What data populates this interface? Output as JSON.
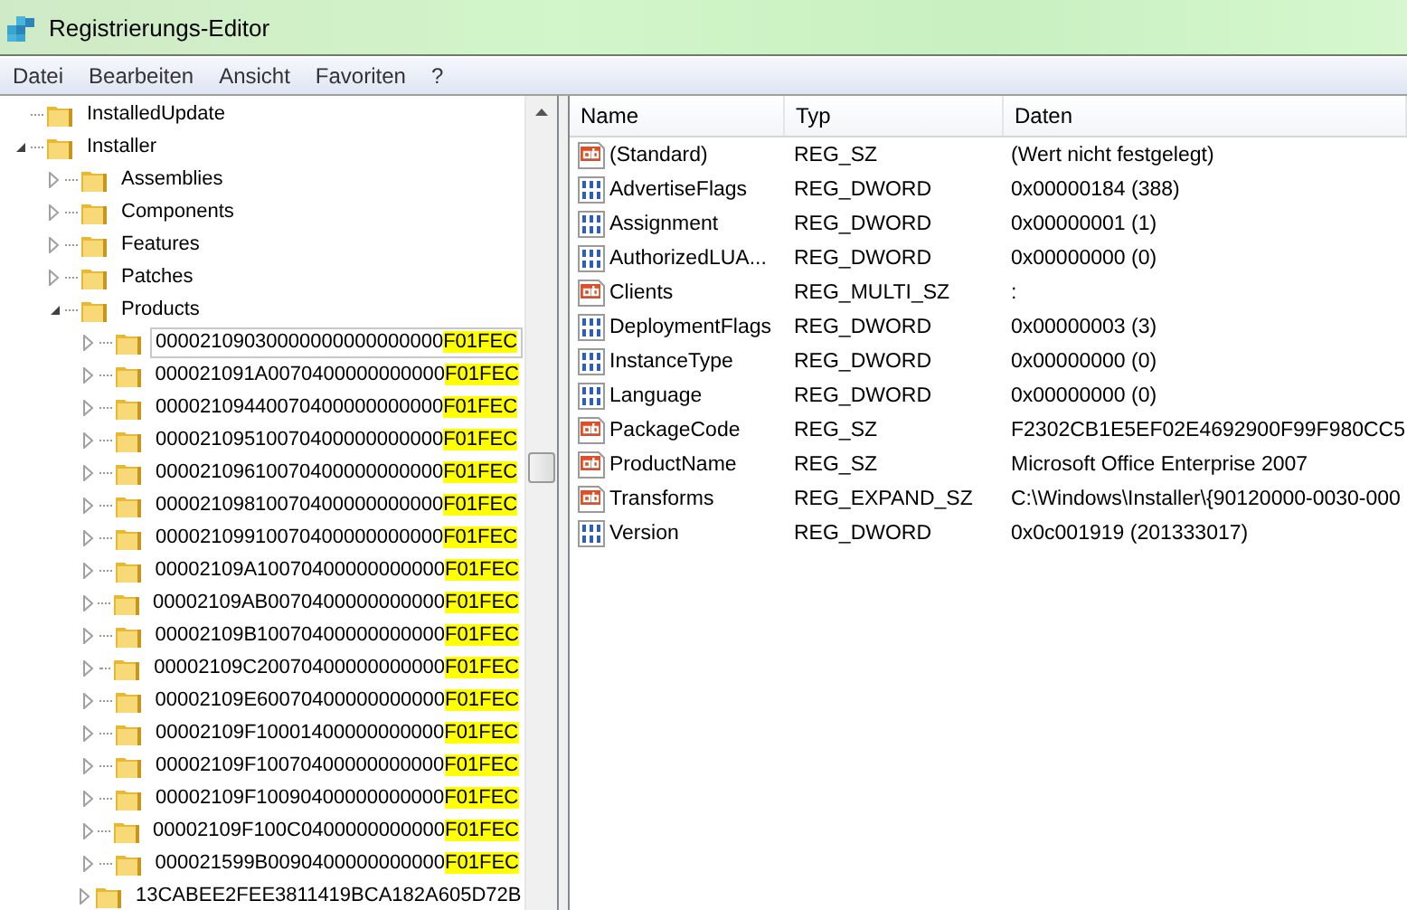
{
  "window": {
    "title": "Registrierungs-Editor"
  },
  "menu": [
    "Datei",
    "Bearbeiten",
    "Ansicht",
    "Favoriten",
    "?"
  ],
  "tree": [
    {
      "label": "InstalledUpdate"
    },
    {
      "label": "Installer",
      "expanded": true,
      "children": [
        {
          "label": "Assemblies",
          "expanded": false
        },
        {
          "label": "Components",
          "expanded": false
        },
        {
          "label": "Features",
          "expanded": false
        },
        {
          "label": "Patches",
          "expanded": false
        },
        {
          "label": "Products",
          "expanded": true,
          "children": [
            {
              "label": "00002109030000000000000000",
              "highlight": "F01FEC",
              "expanded": false,
              "selected": true
            },
            {
              "label": "000021091A0070400000000000",
              "highlight": "F01FEC",
              "expanded": false,
              "selected": false
            },
            {
              "label": "00002109440070400000000000",
              "highlight": "F01FEC",
              "expanded": false,
              "selected": false
            },
            {
              "label": "00002109510070400000000000",
              "highlight": "F01FEC",
              "expanded": false,
              "selected": false
            },
            {
              "label": "00002109610070400000000000",
              "highlight": "F01FEC",
              "expanded": false,
              "selected": false
            },
            {
              "label": "00002109810070400000000000",
              "highlight": "F01FEC",
              "expanded": false,
              "selected": false
            },
            {
              "label": "00002109910070400000000000",
              "highlight": "F01FEC",
              "expanded": false,
              "selected": false
            },
            {
              "label": "00002109A10070400000000000",
              "highlight": "F01FEC",
              "expanded": false,
              "selected": false
            },
            {
              "label": "00002109AB0070400000000000",
              "highlight": "F01FEC",
              "expanded": false,
              "selected": false
            },
            {
              "label": "00002109B10070400000000000",
              "highlight": "F01FEC",
              "expanded": false,
              "selected": false
            },
            {
              "label": "00002109C20070400000000000",
              "highlight": "F01FEC",
              "expanded": false,
              "selected": false
            },
            {
              "label": "00002109E60070400000000000",
              "highlight": "F01FEC",
              "expanded": false,
              "selected": false
            },
            {
              "label": "00002109F10001400000000000",
              "highlight": "F01FEC",
              "expanded": false,
              "selected": false
            },
            {
              "label": "00002109F10070400000000000",
              "highlight": "F01FEC",
              "expanded": false,
              "selected": false
            },
            {
              "label": "00002109F10090400000000000",
              "highlight": "F01FEC",
              "expanded": false,
              "selected": false
            },
            {
              "label": "00002109F100C0400000000000",
              "highlight": "F01FEC",
              "expanded": false,
              "selected": false
            },
            {
              "label": "000021599B0090400000000000",
              "highlight": "F01FEC",
              "expanded": false,
              "selected": false
            },
            {
              "label": "13CABEE2FEE3811419BCA182A605D72B",
              "expanded": false,
              "selected": false
            }
          ]
        }
      ]
    }
  ],
  "table": {
    "columns": [
      "Name",
      "Typ",
      "Daten"
    ],
    "rows": [
      {
        "kind": "string",
        "name": "(Standard)",
        "type": "REG_SZ",
        "data": "(Wert nicht festgelegt)"
      },
      {
        "kind": "binary",
        "name": "AdvertiseFlags",
        "type": "REG_DWORD",
        "data": "0x00000184 (388)"
      },
      {
        "kind": "binary",
        "name": "Assignment",
        "type": "REG_DWORD",
        "data": "0x00000001 (1)"
      },
      {
        "kind": "binary",
        "name": "AuthorizedLUA...",
        "type": "REG_DWORD",
        "data": "0x00000000 (0)"
      },
      {
        "kind": "string",
        "name": "Clients",
        "type": "REG_MULTI_SZ",
        "data": ":"
      },
      {
        "kind": "binary",
        "name": "DeploymentFlags",
        "type": "REG_DWORD",
        "data": "0x00000003 (3)"
      },
      {
        "kind": "binary",
        "name": "InstanceType",
        "type": "REG_DWORD",
        "data": "0x00000000 (0)"
      },
      {
        "kind": "binary",
        "name": "Language",
        "type": "REG_DWORD",
        "data": "0x00000000 (0)"
      },
      {
        "kind": "string",
        "name": "PackageCode",
        "type": "REG_SZ",
        "data": "F2302CB1E5EF02E4692900F99F980CC5"
      },
      {
        "kind": "string",
        "name": "ProductName",
        "type": "REG_SZ",
        "data": "Microsoft Office Enterprise 2007"
      },
      {
        "kind": "string",
        "name": "Transforms",
        "type": "REG_EXPAND_SZ",
        "data": "C:\\Windows\\Installer\\{90120000-0030-000"
      },
      {
        "kind": "binary",
        "name": "Version",
        "type": "REG_DWORD",
        "data": "0x0c001919 (201333017)"
      }
    ]
  }
}
